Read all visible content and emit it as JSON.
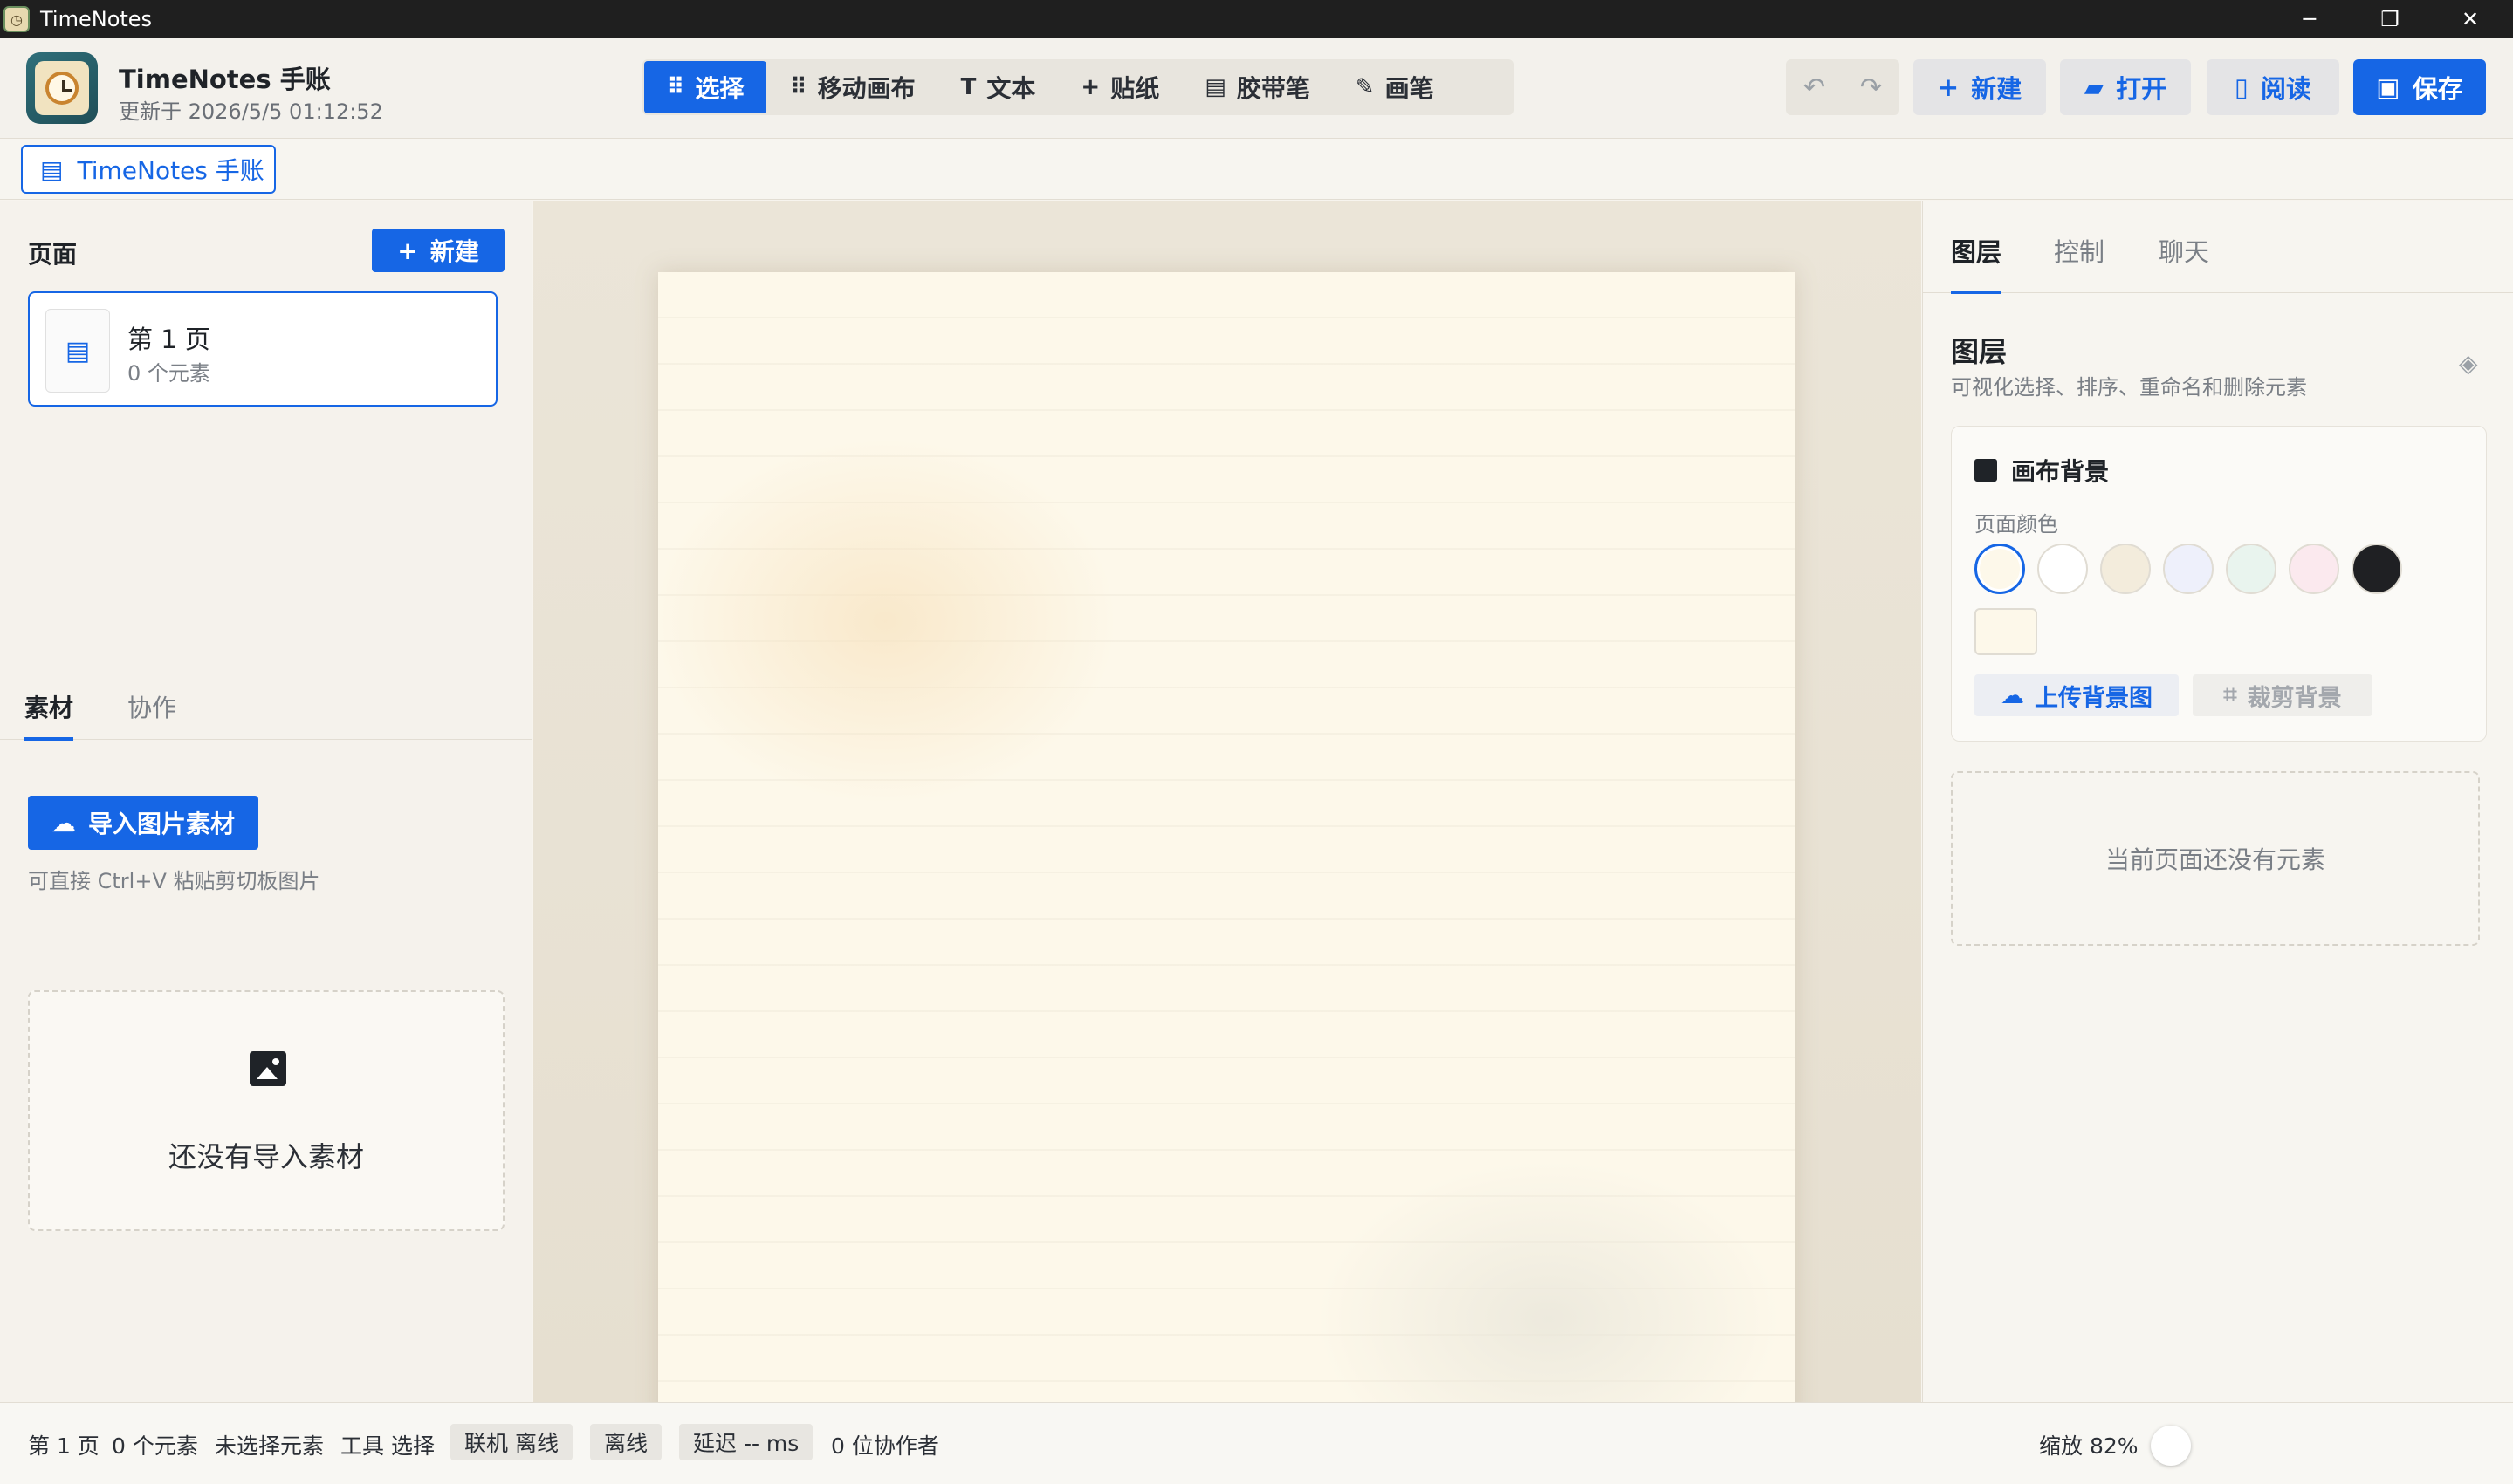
{
  "window": {
    "title": "TimeNotes",
    "controls": {
      "minimize": "─",
      "restore": "❐",
      "close": "✕"
    }
  },
  "header": {
    "app_name": "TimeNotes 手账",
    "updated": "更新于 2026/5/5 01:12:52",
    "tools": [
      {
        "label": "选择",
        "icon": "drag-grid-icon",
        "glyph": "⠿",
        "active": true
      },
      {
        "label": "移动画布",
        "icon": "drag-grid-icon",
        "glyph": "⠿",
        "active": false
      },
      {
        "label": "文本",
        "icon": "text-icon",
        "glyph": "T",
        "active": false
      },
      {
        "label": "贴纸",
        "icon": "plus-icon",
        "glyph": "+",
        "active": false
      },
      {
        "label": "胶带笔",
        "icon": "document-icon",
        "glyph": "▤",
        "active": false
      },
      {
        "label": "画笔",
        "icon": "edit-icon",
        "glyph": "✎",
        "active": false
      }
    ],
    "undo_glyph": "↶",
    "redo_glyph": "↷",
    "new_label": "新建",
    "open_label": "打开",
    "read_label": "阅读",
    "save_label": "保存"
  },
  "doc_tab": {
    "label": "TimeNotes 手账"
  },
  "left_panel": {
    "pages_title": "页面",
    "new_page_label": "新建",
    "pages": [
      {
        "name": "第 1 页",
        "meta": "0 个元素"
      }
    ],
    "tabs": [
      {
        "label": "素材",
        "active": true
      },
      {
        "label": "协作",
        "active": false
      }
    ],
    "import_label": "导入图片素材",
    "import_hint": "可直接 Ctrl+V 粘贴剪切板图片",
    "empty_text": "还没有导入素材"
  },
  "right_panel": {
    "tabs": [
      {
        "label": "图层",
        "active": true
      },
      {
        "label": "控制",
        "active": false
      },
      {
        "label": "聊天",
        "active": false
      }
    ],
    "title": "图层",
    "subtitle": "可视化选择、排序、重命名和删除元素",
    "bg_card_title": "画布背景",
    "page_color_label": "页面颜色",
    "swatches": [
      "#fdf8ea",
      "#ffffff",
      "#f3ecdc",
      "#eef0fb",
      "#e9f4ee",
      "#fbe9ee",
      "#1f2023"
    ],
    "selected_swatch": 0,
    "upload_label": "上传背景图",
    "crop_label": "裁剪背景",
    "empty_text": "当前页面还没有元素"
  },
  "status": {
    "page": "第 1 页",
    "elements": "0 个元素",
    "selection": "未选择元素",
    "tool": "工具 选择",
    "online": "联机 离线",
    "offline": "离线",
    "latency": "延迟 -- ms",
    "collaborators": "0 位协作者",
    "zoom": "缩放 82%"
  },
  "colors": {
    "accent": "#1666e5",
    "paper": "#fdf8ea"
  }
}
